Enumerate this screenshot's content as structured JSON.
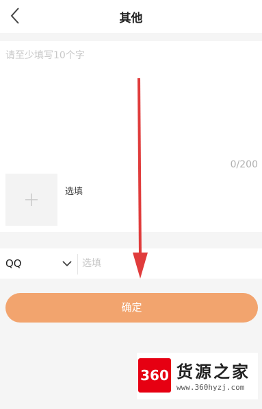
{
  "header": {
    "title": "其他",
    "back_icon": "chevron-left-icon"
  },
  "feedback": {
    "placeholder": "请至少填写10个字",
    "counter": "0/200",
    "upload_icon": "plus-icon",
    "upload_hint": "选填"
  },
  "contact": {
    "type_value": "QQ",
    "type_icon": "chevron-down-icon",
    "placeholder": "选填"
  },
  "actions": {
    "confirm_label": "确定",
    "confirm_color": "#f2a46e"
  },
  "annotation": {
    "arrow_color": "#e03c3c"
  },
  "watermark": {
    "logo_text": "360",
    "name": "货源之家",
    "url": "www.360hyzj.com"
  }
}
